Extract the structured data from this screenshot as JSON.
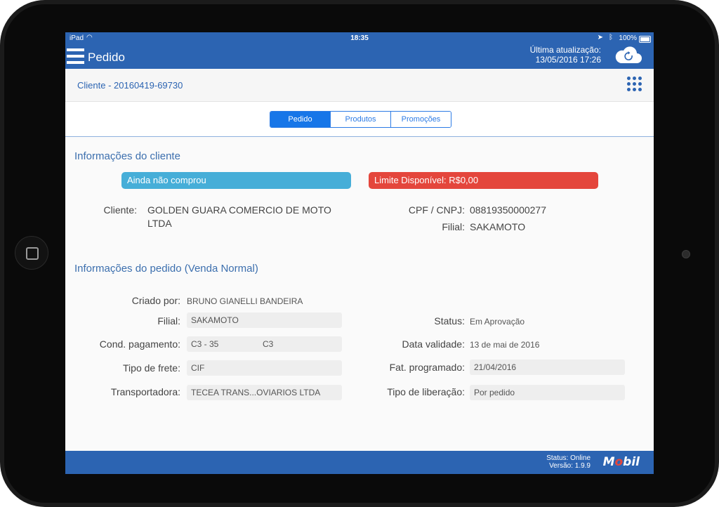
{
  "status_bar": {
    "device": "iPad",
    "time": "18:35",
    "battery": "100%"
  },
  "nav": {
    "title": "Pedido",
    "last_update_label": "Última atualização:",
    "last_update_value": "13/05/2016 17:26"
  },
  "client_code": "Cliente - 20160419-69730",
  "tabs": [
    "Pedido",
    "Produtos",
    "Promoções"
  ],
  "active_tab": "Pedido",
  "client_info": {
    "title": "Informações do cliente",
    "badge_purchase": "Ainda não comprou",
    "badge_limit": "Limite Disponível: R$0,00",
    "cliente_label": "Cliente:",
    "cliente_value_line1": "GOLDEN GUARA COMERCIO DE MOTO",
    "cliente_value_line2": "LTDA",
    "cpf_label": "CPF / CNPJ:",
    "cpf_value": "08819350000277",
    "filial_label": "Filial:",
    "filial_value": "SAKAMOTO"
  },
  "order_info": {
    "title": "Informações do pedido (Venda Normal)",
    "criado_por_label": "Criado por:",
    "criado_por_value": "BRUNO GIANELLI BANDEIRA",
    "filial_label": "Filial:",
    "filial_value": "SAKAMOTO",
    "cond_label": "Cond. pagamento:",
    "cond_code": "C3 - 35",
    "cond_value": "C3",
    "frete_label": "Tipo de frete:",
    "frete_value": "CIF",
    "transportadora_label": "Transportadora:",
    "transportadora_value": "TECEA TRANS...OVIARIOS LTDA",
    "status_label": "Status:",
    "status_value": "Em Aprovação",
    "validade_label": "Data validade:",
    "validade_value": "13 de mai de 2016",
    "fat_label": "Fat. programado:",
    "fat_value": "21/04/2016",
    "liberacao_label": "Tipo de liberação:",
    "liberacao_value": "Por pedido"
  },
  "footer": {
    "status": "Status: Online",
    "version": "Versão: 1.9.9",
    "logo": "Mobil"
  },
  "colors": {
    "primary": "#2c64b2",
    "accent_blue": "#46aed8",
    "accent_red": "#e4463c",
    "tab_active": "#1776e8"
  }
}
